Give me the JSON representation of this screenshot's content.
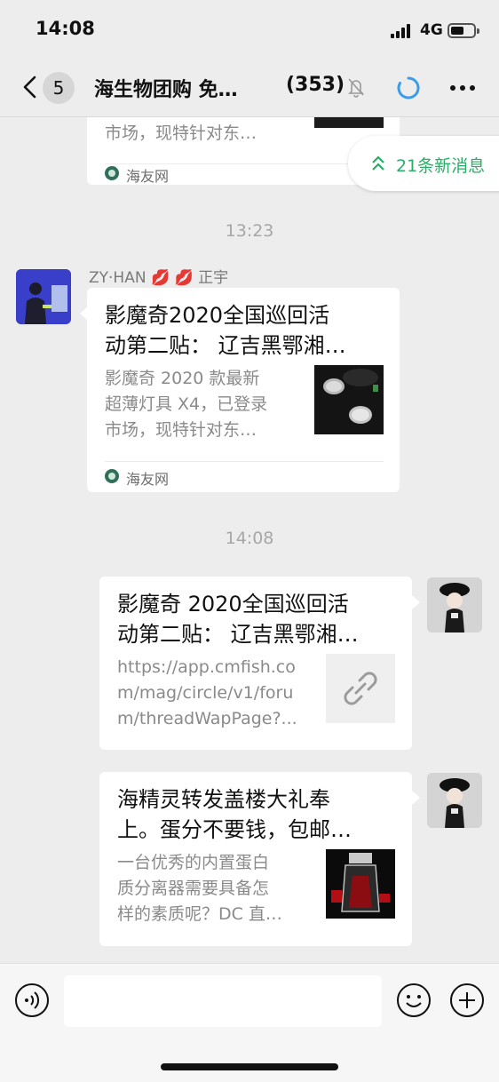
{
  "status_bar": {
    "time": "14:08",
    "network": "4G"
  },
  "nav": {
    "back_badge": "5",
    "title": "海生物团购 免…",
    "member_count": "(353)"
  },
  "new_messages": {
    "label": "21条新消息"
  },
  "messages": [
    {
      "type": "link-card",
      "side": "left",
      "desc_tail": "市场，现特针对东…",
      "source": "海友网"
    },
    {
      "type": "time",
      "text": "13:23"
    },
    {
      "type": "link-card",
      "side": "left",
      "sender": "ZY·HAN 💋 💋 正宇",
      "title_line1": "影魔奇2020全国巡回活",
      "title_line2": "动第二贴： 辽吉黑鄂湘…",
      "desc_line1": "影魔奇 2020 款最新",
      "desc_line2": "超薄灯具 X4，已登录",
      "desc_line3": "市场，现特针对东…",
      "source": "海友网"
    },
    {
      "type": "time",
      "text": "14:08"
    },
    {
      "type": "link-card",
      "side": "right",
      "title_line1": "影魔奇 2020全国巡回活",
      "title_line2": "动第二贴： 辽吉黑鄂湘…",
      "desc_line1": "https://app.cmfish.co",
      "desc_line2": "m/mag/circle/v1/foru",
      "desc_line3": "m/threadWapPage?..."
    },
    {
      "type": "link-card",
      "side": "right",
      "title_line1": "海精灵转发盖楼大礼奉",
      "title_line2": "上。蛋分不要钱，包邮…",
      "desc_line1": "一台优秀的内置蛋白",
      "desc_line2": "质分离器需要具备怎",
      "desc_line3": "样的素质呢？DC 直…"
    }
  ],
  "icons": {
    "back": "chevron-left-icon",
    "mute": "bell-slash-icon",
    "loading": "loading-ring-icon",
    "more": "ellipsis-icon",
    "voice": "voice-icon",
    "emoji": "emoji-icon",
    "plus": "plus-icon",
    "link": "link-icon"
  },
  "colors": {
    "background": "#ededed",
    "accent_green": "#2aae67",
    "loading_blue": "#3b9de6"
  }
}
